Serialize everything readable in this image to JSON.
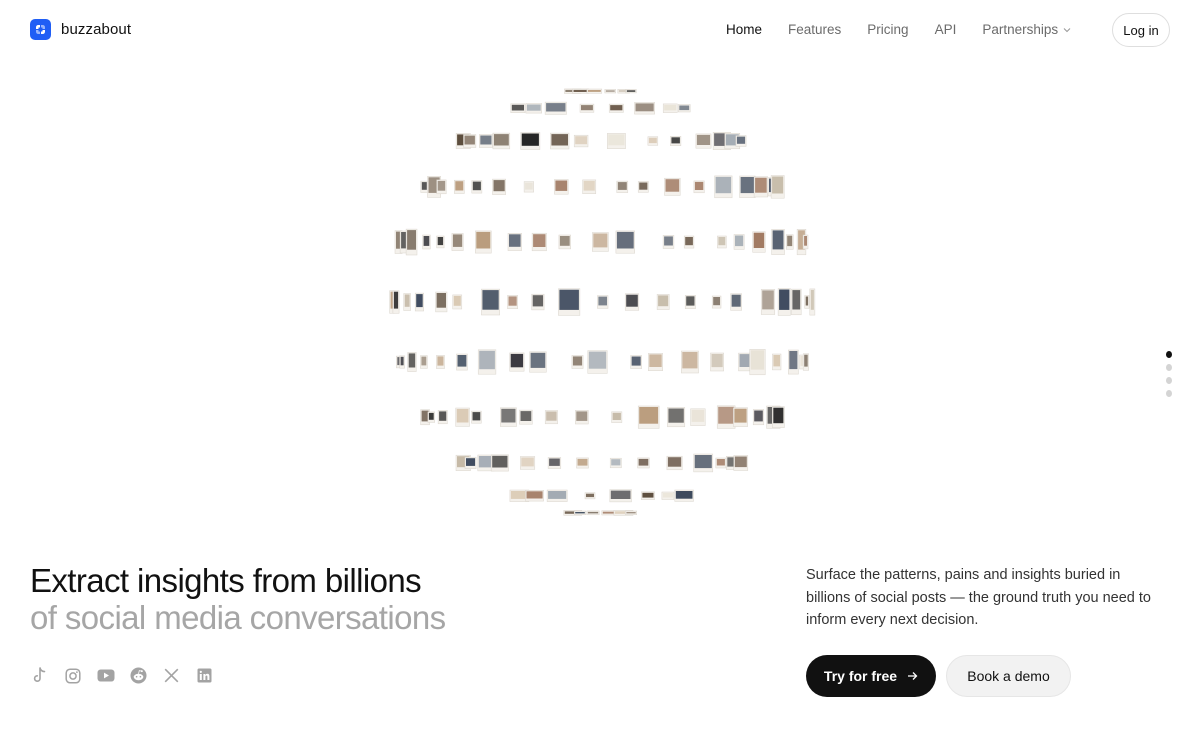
{
  "brand": {
    "name": "buzzabout",
    "accent": "#1f5ef5"
  },
  "nav": {
    "items": [
      {
        "label": "Home",
        "active": true
      },
      {
        "label": "Features",
        "active": false
      },
      {
        "label": "Pricing",
        "active": false
      },
      {
        "label": "API",
        "active": false
      },
      {
        "label": "Partnerships",
        "active": false,
        "dropdown": true
      }
    ],
    "login_label": "Log in"
  },
  "hero": {
    "headline_line1": "Extract insights from billions",
    "headline_line2": "of social media conversations",
    "description": "Surface the patterns, pains and insights buried in billions of social posts — the ground truth you need to inform every next decision.",
    "primary_cta": "Try for free",
    "secondary_cta": "Book a demo",
    "socials": [
      "tiktok-icon",
      "instagram-icon",
      "youtube-icon",
      "reddit-icon",
      "x-icon",
      "linkedin-icon"
    ]
  },
  "pagination": {
    "count": 4,
    "active_index": 0
  }
}
